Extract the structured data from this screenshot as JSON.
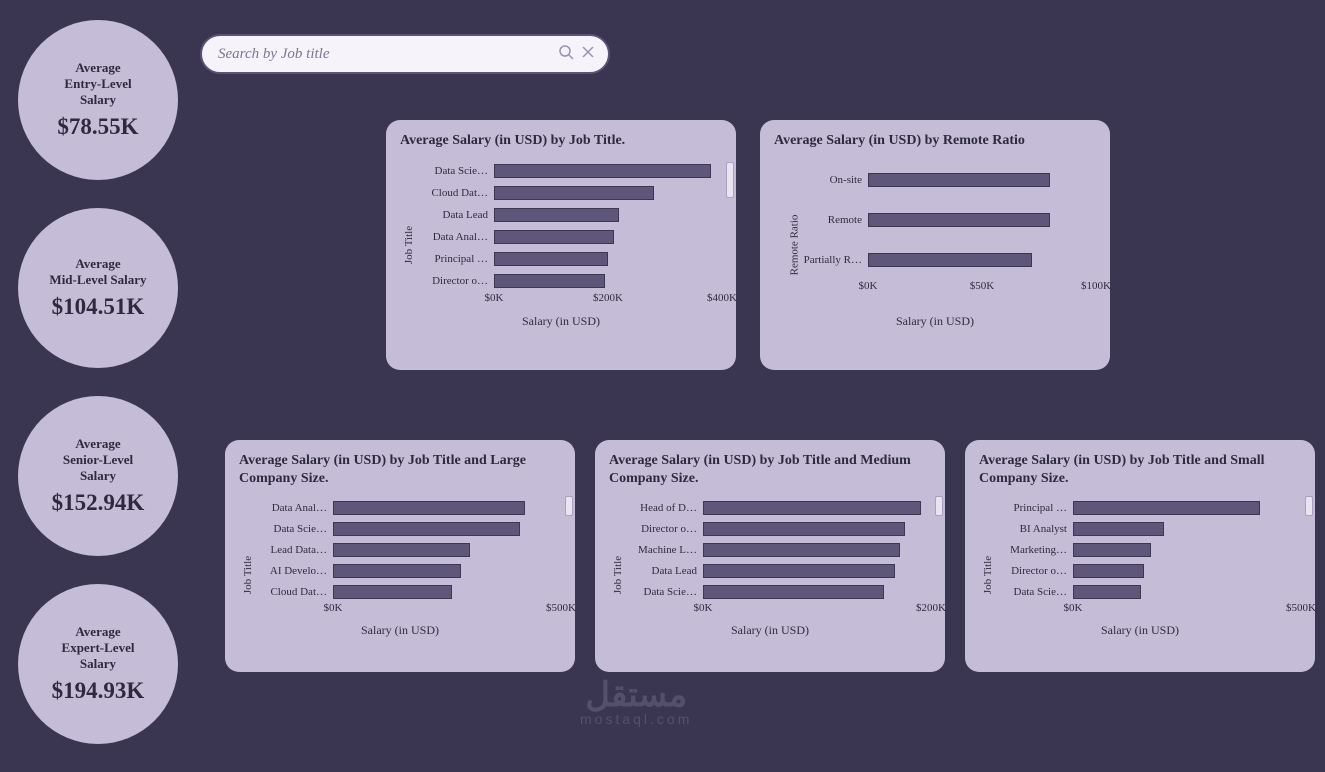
{
  "search": {
    "placeholder": "Search by Job title"
  },
  "kpi": [
    {
      "label": "Average\nEntry-Level\nSalary",
      "value": "$78.55K"
    },
    {
      "label": "Average\nMid-Level Salary",
      "value": "$104.51K"
    },
    {
      "label": "Average\nSenior-Level\nSalary",
      "value": "$152.94K"
    },
    {
      "label": "Average\nExpert-Level\nSalary",
      "value": "$194.93K"
    }
  ],
  "cards": {
    "byTitle": {
      "title": "Average Salary (in USD) by Job Title.",
      "ylabel": "Job Title",
      "xlabel": "Salary (in USD)"
    },
    "byRemote": {
      "title": "Average Salary (in USD) by Remote Ratio",
      "ylabel": "Remote Ratio",
      "xlabel": "Salary (in USD)"
    },
    "large": {
      "title": "Average Salary (in USD) by Job Title and Large Company Size.",
      "ylabel": "Job Title",
      "xlabel": "Salary (in USD)"
    },
    "medium": {
      "title": "Average Salary (in USD) by Job Title and Medium Company Size.",
      "ylabel": "Job Title",
      "xlabel": "Salary (in USD)"
    },
    "small": {
      "title": "Average Salary (in USD) by Job Title and Small Company Size.",
      "ylabel": "Job Title",
      "xlabel": "Salary (in USD)"
    }
  },
  "watermark": {
    "site": "mostaql.com"
  },
  "chart_data": [
    {
      "id": "byTitle",
      "type": "bar",
      "orientation": "horizontal",
      "title": "Average Salary (in USD) by Job Title.",
      "xlabel": "Salary (in USD)",
      "ylabel": "Job Title",
      "ticks": [
        "$0K",
        "$200K",
        "$400K"
      ],
      "xmax": 400,
      "categories": [
        "Data Scie…",
        "Cloud Dat…",
        "Data Lead",
        "Data Anal…",
        "Principal …",
        "Director o…"
      ],
      "values": [
        380,
        280,
        220,
        210,
        200,
        195
      ],
      "has_scroll": true
    },
    {
      "id": "byRemote",
      "type": "bar",
      "orientation": "horizontal",
      "title": "Average Salary (in USD) by Remote Ratio",
      "xlabel": "Salary (in USD)",
      "ylabel": "Remote Ratio",
      "ticks": [
        "$0K",
        "$50K",
        "$100K"
      ],
      "xmax": 100,
      "categories": [
        "On-site",
        "Remote",
        "Partially R…"
      ],
      "values": [
        80,
        80,
        72
      ],
      "has_scroll": false
    },
    {
      "id": "large",
      "type": "bar",
      "orientation": "horizontal",
      "title": "Average Salary (in USD) by Job Title and Large Company Size.",
      "xlabel": "Salary (in USD)",
      "ylabel": "Job Title",
      "ticks": [
        "$0K",
        "$500K"
      ],
      "xmax": 500,
      "categories": [
        "Data Anal…",
        "Data Scie…",
        "Lead Data…",
        "AI Develo…",
        "Cloud Dat…"
      ],
      "values": [
        420,
        410,
        300,
        280,
        260
      ],
      "has_scroll": true
    },
    {
      "id": "medium",
      "type": "bar",
      "orientation": "horizontal",
      "title": "Average Salary (in USD) by Job Title and Medium Company Size.",
      "xlabel": "Salary (in USD)",
      "ylabel": "Job Title",
      "ticks": [
        "$0K",
        "$200K"
      ],
      "xmax": 220,
      "categories": [
        "Head of D…",
        "Director o…",
        "Machine L…",
        "Data Lead",
        "Data Scie…"
      ],
      "values": [
        210,
        195,
        190,
        185,
        175
      ],
      "has_scroll": true
    },
    {
      "id": "small",
      "type": "bar",
      "orientation": "horizontal",
      "title": "Average Salary (in USD) by Job Title and Small Company Size.",
      "xlabel": "Salary (in USD)",
      "ylabel": "Job Title",
      "ticks": [
        "$0K",
        "$500K"
      ],
      "xmax": 500,
      "categories": [
        "Principal …",
        "BI Analyst",
        "Marketing…",
        "Director o…",
        "Data Scie…"
      ],
      "values": [
        410,
        200,
        170,
        155,
        150
      ],
      "has_scroll": true
    }
  ]
}
